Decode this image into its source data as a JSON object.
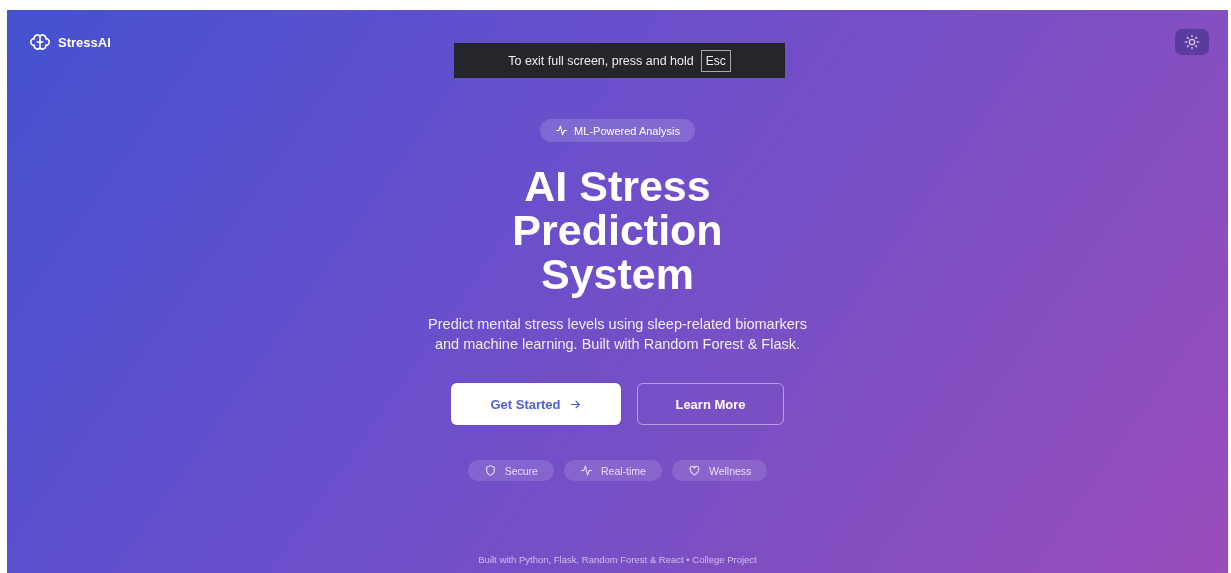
{
  "nav": {
    "brand": "StressAI"
  },
  "fullscreen_notice": {
    "text": "To exit full screen, press and hold",
    "key": "Esc"
  },
  "hero": {
    "badge": "ML-Powered Analysis",
    "title_lines": [
      "AI Stress",
      "Prediction",
      "System"
    ],
    "description": "Predict mental stress levels using sleep-related biomarkers and machine learning. Built with Random Forest & Flask.",
    "buttons": [
      {
        "label": "Get Started",
        "kind": "primary"
      },
      {
        "label": "Learn More",
        "kind": "outline"
      }
    ],
    "features": [
      "Secure",
      "Real-time",
      "Wellness"
    ]
  },
  "footer": "Built with Python, Flask, Random Forest & React • College Project"
}
